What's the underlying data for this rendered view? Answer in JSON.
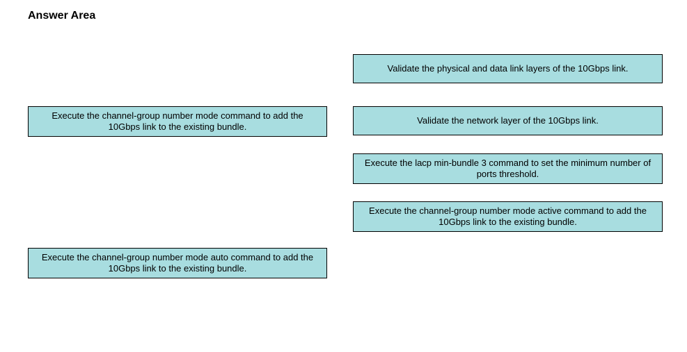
{
  "heading": "Answer Area",
  "left_items": [
    {
      "text": "Execute the channel-group number mode command to add the 10Gbps link to the existing bundle."
    },
    {
      "text": "Execute the channel-group number mode auto command to add the 10Gbps link to the existing bundle."
    }
  ],
  "right_items": [
    {
      "text": "Validate the physical and data link layers of the 10Gbps link."
    },
    {
      "text": "Validate the network layer of the 10Gbps link."
    },
    {
      "text": "Execute the lacp min-bundle 3 command to set the minimum number of ports threshold."
    },
    {
      "text": "Execute the channel-group number mode active command to add the 10Gbps link to the existing bundle."
    }
  ],
  "colors": {
    "box_fill": "#a8dde0",
    "box_border": "#000000"
  }
}
